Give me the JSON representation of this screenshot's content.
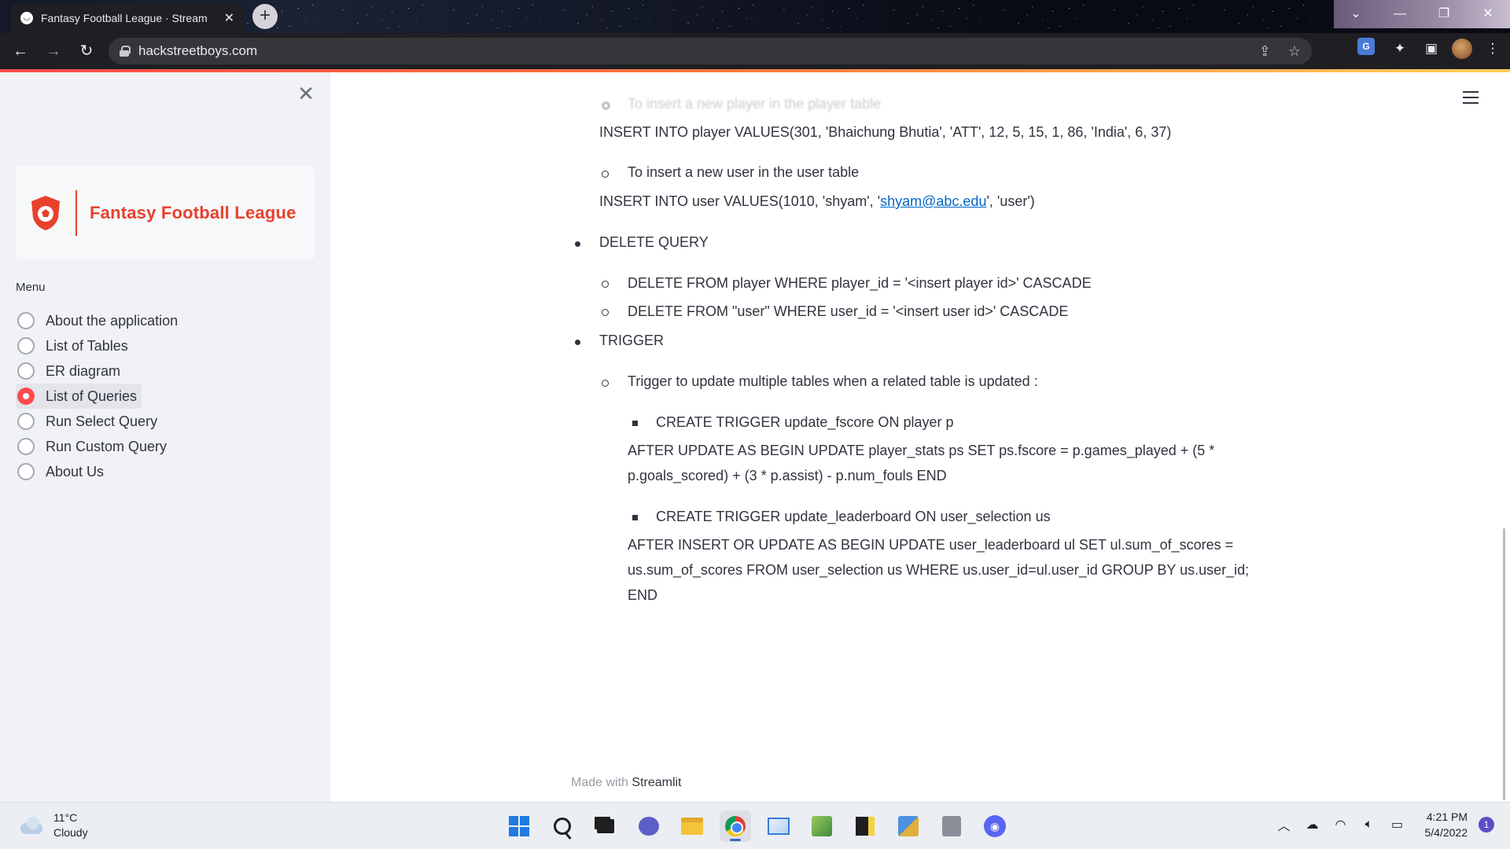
{
  "browser": {
    "tab_title": "Fantasy Football League · Stream",
    "tab_close": "✕",
    "new_tab": "+",
    "url": "hackstreetboys.com",
    "window_controls": [
      "⌄",
      "—",
      "❐",
      "✕"
    ]
  },
  "sidebar": {
    "close_glyph": "✕",
    "logo_text": "Fantasy Football League",
    "menu_label": "Menu",
    "items": [
      {
        "label": "About the application",
        "checked": false
      },
      {
        "label": "List of Tables",
        "checked": false
      },
      {
        "label": "ER diagram",
        "checked": false
      },
      {
        "label": "List of Queries",
        "checked": true
      },
      {
        "label": "Run Select Query",
        "checked": false
      },
      {
        "label": "Run Custom Query",
        "checked": false
      },
      {
        "label": "About Us",
        "checked": false
      }
    ]
  },
  "content": {
    "faded_top": "To insert a new player in the player table",
    "insert_player": "INSERT INTO player VALUES(301, 'Bhaichung Bhutia', 'ATT', 12, 5, 15, 1, 86, 'India', 6, 37)",
    "insert_user_heading": "To insert a new user in the user table",
    "insert_user_pre": "INSERT INTO user VALUES(1010, 'shyam', '",
    "insert_user_email": "shyam@abc.edu",
    "insert_user_post": "', 'user')",
    "delete_heading": "DELETE QUERY",
    "delete_player": "DELETE FROM player WHERE player_id = '<insert player id>' CASCADE",
    "delete_user": "DELETE FROM \"user\" WHERE user_id = '<insert user id>' CASCADE",
    "trigger_heading": "TRIGGER",
    "trigger_desc": "Trigger to update multiple tables when a related table is updated :",
    "trigger1_title": "CREATE TRIGGER update_fscore ON player p",
    "trigger1_line1": "AFTER UPDATE AS BEGIN UPDATE player_stats ps SET ps.fscore = p.games_played + (5 *",
    "trigger1_line2": "p.goals_scored) + (3 * p.assist) - p.num_fouls END",
    "trigger2_title": "CREATE TRIGGER update_leaderboard ON user_selection us",
    "trigger2_line1": "AFTER INSERT OR UPDATE AS BEGIN UPDATE user_leaderboard ul SET ul.sum_of_scores =",
    "trigger2_line2": "us.sum_of_scores FROM user_selection us WHERE us.user_id=ul.user_id GROUP BY us.user_id;",
    "trigger2_line3": "END",
    "footer_prefix": "Made with ",
    "footer_brand": "Streamlit"
  },
  "taskbar": {
    "temperature": "11°C",
    "condition": "Cloudy",
    "time": "4:21 PM",
    "date": "5/4/2022",
    "notifications": "1"
  },
  "colors": {
    "accent": "#ff4b4b",
    "logo": "#e8412c",
    "link": "#0068c9"
  }
}
